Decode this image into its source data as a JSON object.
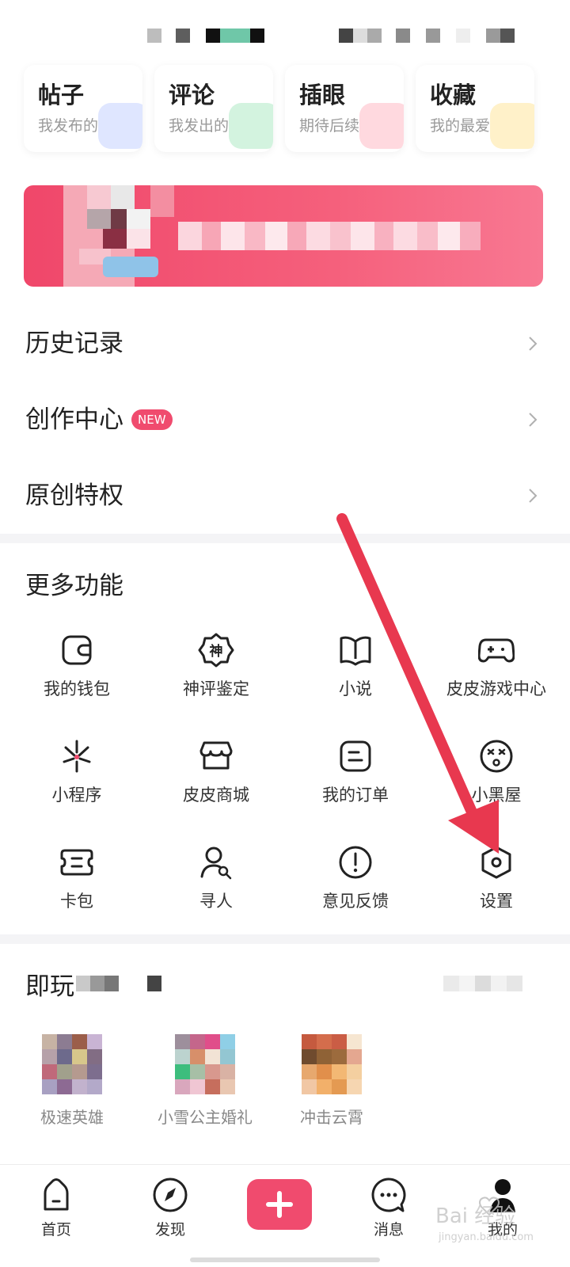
{
  "quick_cards": [
    {
      "title": "帖子",
      "subtitle": "我发布的",
      "accent": "#dfe6ff"
    },
    {
      "title": "评论",
      "subtitle": "我发出的",
      "accent": "#d3f3df"
    },
    {
      "title": "插眼",
      "subtitle": "期待后续",
      "accent": "#ffd9df"
    },
    {
      "title": "收藏",
      "subtitle": "我的最爱",
      "accent": "#fff1c9"
    }
  ],
  "menu": {
    "history": "历史记录",
    "creation_center": "创作中心",
    "creation_badge": "NEW",
    "original_privilege": "原创特权"
  },
  "more_functions": {
    "title": "更多功能",
    "items": [
      {
        "label": "我的钱包",
        "icon": "wallet-icon"
      },
      {
        "label": "神评鉴定",
        "icon": "shen-badge-icon",
        "glyph": "神"
      },
      {
        "label": "小说",
        "icon": "book-icon"
      },
      {
        "label": "皮皮游戏中心",
        "icon": "gamepad-icon"
      },
      {
        "label": "小程序",
        "icon": "mini-program-icon"
      },
      {
        "label": "皮皮商城",
        "icon": "store-icon"
      },
      {
        "label": "我的订单",
        "icon": "order-icon"
      },
      {
        "label": "小黑屋",
        "icon": "dizzy-face-icon"
      },
      {
        "label": "卡包",
        "icon": "card-pack-icon"
      },
      {
        "label": "寻人",
        "icon": "find-person-icon"
      },
      {
        "label": "意见反馈",
        "icon": "feedback-icon"
      },
      {
        "label": "设置",
        "icon": "settings-icon"
      }
    ]
  },
  "instant_play": {
    "title": "即玩",
    "games": [
      {
        "name": "极速英雄"
      },
      {
        "name": "小雪公主婚礼"
      },
      {
        "name": "冲击云霄"
      }
    ]
  },
  "bottom_nav": [
    {
      "label": "首页",
      "icon": "home-icon"
    },
    {
      "label": "发现",
      "icon": "compass-icon"
    },
    {
      "label": "",
      "icon": "plus-icon"
    },
    {
      "label": "消息",
      "icon": "message-icon"
    },
    {
      "label": "我的",
      "icon": "profile-icon"
    }
  ],
  "colors": {
    "accent": "#f04b6e",
    "annotation_arrow": "#e8384f"
  }
}
